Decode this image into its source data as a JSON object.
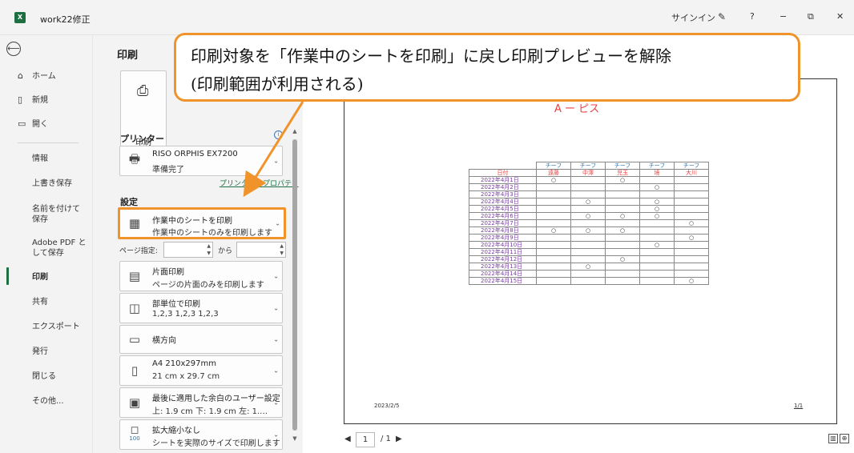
{
  "window": {
    "app_icon_letter": "X",
    "title": "work22修正",
    "signin": "サインイン",
    "help": "?",
    "minimize": "−",
    "restore": "⧉",
    "close": "✕"
  },
  "nav": {
    "back_icon": "⟵",
    "home": "ホーム",
    "new": "新規",
    "open": "開く",
    "info": "情報",
    "save": "上書き保存",
    "save_as": "名前を付けて保存",
    "adobe_pdf": "Adobe PDF として保存",
    "print": "印刷",
    "share": "共有",
    "export": "エクスポート",
    "publish": "発行",
    "close": "閉じる",
    "more": "その他..."
  },
  "print_panel": {
    "heading": "印刷",
    "print_button": "印刷",
    "printer_label": "プリンター",
    "printer_name": "RISO ORPHIS EX7200",
    "printer_status": "準備完了",
    "printer_properties": "プリンターのプロパティ",
    "settings_label": "設定",
    "what_to_print": "作業中のシートを印刷",
    "what_to_print_desc": "作業中のシートのみを印刷します",
    "pages_label": "ページ指定:",
    "pages_to": "から",
    "sides": "片面印刷",
    "sides_desc": "ページの片面のみを印刷します",
    "collate": "部単位で印刷",
    "collate_desc": "1,2,3    1,2,3    1,2,3",
    "orientation": "横方向",
    "paper_size": "A4 210x297mm",
    "paper_size_desc": "21 cm x 29.7 cm",
    "margins": "最後に適用した余白のユーザー設定",
    "margins_desc": "上: 1.9 cm 下: 1.9 cm 左: 1.…",
    "scaling": "拡大縮小なし",
    "scaling_desc": "シートを実際のサイズで印刷します",
    "scaling_icon_text": "100"
  },
  "preview": {
    "title_fragment": "A  ー  ピス",
    "date_header": "日付",
    "team_labels": [
      "チーフ",
      "チーフ",
      "チーフ",
      "チーフ",
      "チーフ"
    ],
    "names": [
      "遠藤",
      "中澤",
      "児玉",
      "境",
      "大川"
    ],
    "mark": "○",
    "rows": [
      {
        "date": "2022年4月1日",
        "marks": [
          "○",
          "",
          "○",
          "",
          ""
        ]
      },
      {
        "date": "2022年4月2日",
        "marks": [
          "",
          "",
          "",
          "○",
          ""
        ]
      },
      {
        "date": "2022年4月3日",
        "marks": [
          "",
          "",
          "",
          "",
          ""
        ]
      },
      {
        "date": "2022年4月4日",
        "marks": [
          "",
          "○",
          "",
          "○",
          ""
        ]
      },
      {
        "date": "2022年4月5日",
        "marks": [
          "",
          "",
          "",
          "○",
          ""
        ]
      },
      {
        "date": "2022年4月6日",
        "marks": [
          "",
          "○",
          "○",
          "○",
          ""
        ]
      },
      {
        "date": "2022年4月7日",
        "marks": [
          "",
          "",
          "",
          "",
          "○"
        ]
      },
      {
        "date": "2022年4月8日",
        "marks": [
          "○",
          "○",
          "○",
          "",
          ""
        ]
      },
      {
        "date": "2022年4月9日",
        "marks": [
          "",
          "",
          "",
          "",
          "○"
        ]
      },
      {
        "date": "2022年4月10日",
        "marks": [
          "",
          "",
          "",
          "○",
          ""
        ]
      },
      {
        "date": "2022年4月11日",
        "marks": [
          "",
          "",
          "",
          "",
          ""
        ]
      },
      {
        "date": "2022年4月12日",
        "marks": [
          "",
          "",
          "○",
          "",
          ""
        ]
      },
      {
        "date": "2022年4月13日",
        "marks": [
          "",
          "○",
          "",
          "",
          ""
        ]
      },
      {
        "date": "2022年4月14日",
        "marks": [
          "",
          "",
          "",
          "",
          ""
        ]
      },
      {
        "date": "2022年4月15日",
        "marks": [
          "",
          "",
          "",
          "",
          "○"
        ]
      }
    ],
    "footer_date": "2023/2/5",
    "footer_page": "1/1",
    "page_current": "1",
    "page_total": "/ 1"
  },
  "callout": {
    "line1": "印刷対象を「作業中のシートを印刷」に戻し印刷プレビューを解除",
    "line2": "(印刷範囲が利用される)"
  },
  "colors": {
    "excel_green": "#1d6f42",
    "callout_orange": "#f0932b",
    "date_purple": "#7b3aa8",
    "team_blue": "#2e74b5",
    "name_red": "#e8403f"
  }
}
